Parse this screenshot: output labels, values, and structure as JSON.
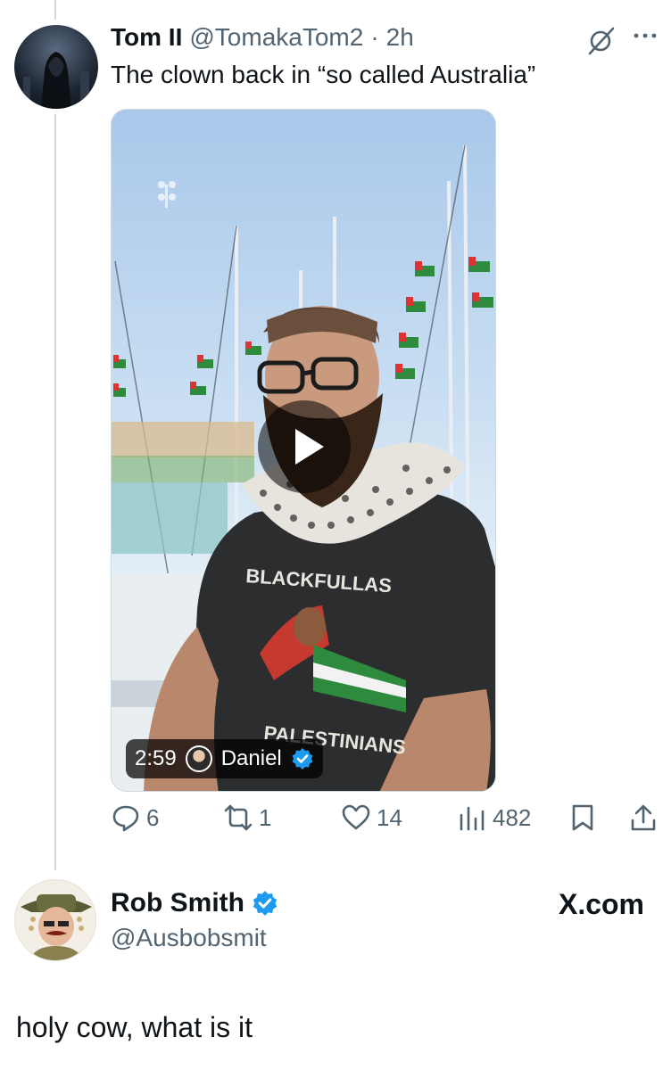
{
  "tweet": {
    "author_name": "Tom II",
    "author_handle": "@TomakaTom2",
    "separator": "·",
    "time": "2h",
    "text": "The clown back in “so called Australia”",
    "media": {
      "duration": "2:59",
      "source_name": "Daniel",
      "shirt_text_top": "BLACKFULLAS",
      "shirt_text_bottom": "PALESTINIANS"
    },
    "stats": {
      "replies": "6",
      "reposts": "1",
      "likes": "14",
      "views": "482"
    }
  },
  "reply": {
    "author_name": "Rob Smith",
    "author_handle": "@Ausbobsmit",
    "site": "X.com",
    "text": "holy cow, what is it"
  },
  "colors": {
    "text": "#0f1419",
    "secondary": "#536471",
    "verified": "#1d9bf0",
    "thread_line": "#cfd9de"
  },
  "icons": [
    "grok-icon",
    "more-icon",
    "play-icon",
    "verified-badge-icon",
    "reply-icon",
    "repost-icon",
    "like-icon",
    "views-icon",
    "bookmark-icon",
    "share-icon"
  ]
}
